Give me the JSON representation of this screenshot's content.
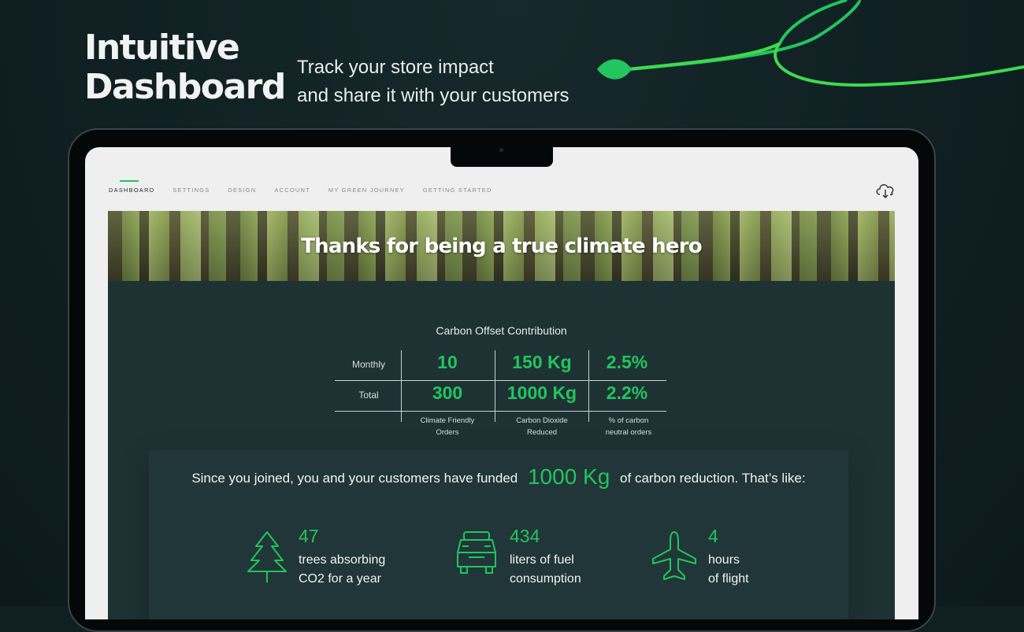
{
  "hero": {
    "title_line1": "Intuitive",
    "title_line2": "Dashboard",
    "subtitle_line1": "Track your store impact",
    "subtitle_line2": "and share it with your customers"
  },
  "colors": {
    "accent": "#22c55e",
    "page_background": "#0f1f22",
    "panel": "#1e3234"
  },
  "nav": {
    "items": [
      {
        "label": "DASHBOARD",
        "active": true
      },
      {
        "label": "SETTINGS",
        "active": false
      },
      {
        "label": "DESIGN",
        "active": false
      },
      {
        "label": "ACCOUNT",
        "active": false
      },
      {
        "label": "MY GREEN JOURNEY",
        "active": false
      },
      {
        "label": "GETTING STARTED",
        "active": false
      }
    ],
    "right_icon": "cloud-icon"
  },
  "banner": {
    "title": "Thanks for being a true climate hero"
  },
  "offset": {
    "title": "Carbon Offset Contribution",
    "rows": [
      {
        "label": "Monthly",
        "orders": "10",
        "co2": "150 Kg",
        "percent": "2.5%"
      },
      {
        "label": "Total",
        "orders": "300",
        "co2": "1000 Kg",
        "percent": "2.2%"
      }
    ],
    "columns": [
      {
        "line1": "Climate Friendly",
        "line2": "Orders"
      },
      {
        "line1": "Carbon Dioxide",
        "line2": "Reduced"
      },
      {
        "line1": "%  of carbon",
        "line2": "neutral orders"
      }
    ]
  },
  "impact": {
    "prefix": "Since you joined, you and your customers have funded",
    "amount": "1000 Kg",
    "suffix": "of carbon reduction. That’s like:",
    "stats": [
      {
        "icon": "tree-icon",
        "value": "47",
        "line1": "trees absorbing",
        "line2": "CO2 for a year"
      },
      {
        "icon": "car-icon",
        "value": "434",
        "line1": "liters of fuel",
        "line2": "consumption"
      },
      {
        "icon": "airplane-icon",
        "value": "4",
        "line1": "hours",
        "line2": "of flight"
      }
    ]
  }
}
